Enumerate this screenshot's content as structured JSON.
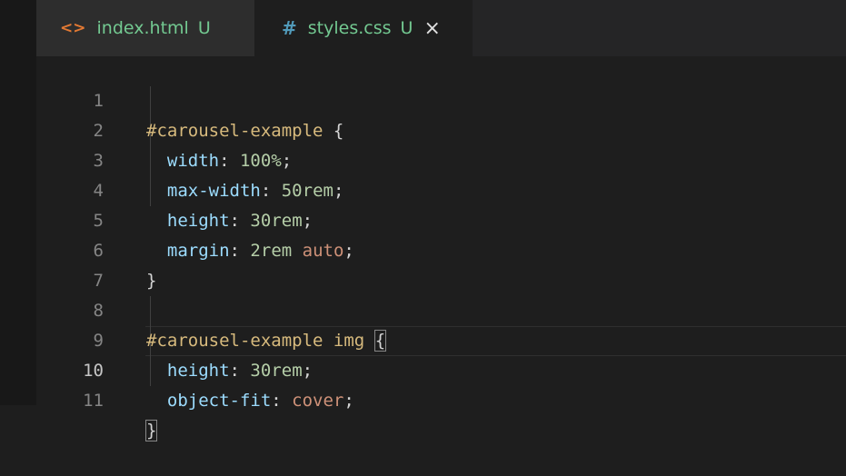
{
  "tabs": [
    {
      "icon": "<>",
      "name": "index.html",
      "status": "U"
    },
    {
      "icon": "#",
      "name": "styles.css",
      "status": "U",
      "close": "×"
    }
  ],
  "line_numbers": [
    "1",
    "2",
    "3",
    "4",
    "5",
    "6",
    "7",
    "8",
    "9",
    "10",
    "11"
  ],
  "code": {
    "l1": {
      "selector": "#carousel-example",
      "brace": " {"
    },
    "l2": {
      "prop": "width",
      "colon": ": ",
      "num": "100",
      "unit": "%",
      "semi": ";"
    },
    "l3": {
      "prop": "max-width",
      "colon": ": ",
      "num": "50",
      "unit": "rem",
      "semi": ";"
    },
    "l4": {
      "prop": "height",
      "colon": ": ",
      "num": "30",
      "unit": "rem",
      "semi": ";"
    },
    "l5": {
      "prop": "margin",
      "colon": ": ",
      "num": "2",
      "unit": "rem",
      "kw": "auto",
      "semi": ";"
    },
    "l6": {
      "brace": "}"
    },
    "l8": {
      "selector": "#carousel-example",
      "tag": "img",
      "brace": "{"
    },
    "l9": {
      "prop": "height",
      "colon": ": ",
      "num": "30",
      "unit": "rem",
      "semi": ";"
    },
    "l10": {
      "prop": "object-fit",
      "colon": ": ",
      "kw": "cover",
      "semi": ";"
    },
    "l11": {
      "brace": "}"
    }
  }
}
